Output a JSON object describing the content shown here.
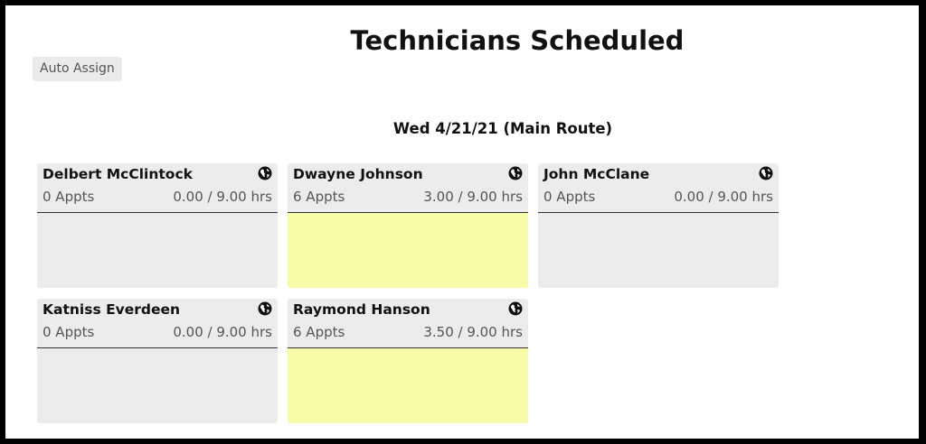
{
  "page": {
    "title": "Technicians Scheduled",
    "auto_assign_label": "Auto Assign",
    "date_header": "Wed 4/21/21 (Main Route)"
  },
  "colors": {
    "card_bg": "#ececec",
    "booked_bg": "#f7fca8",
    "divider": "#333333"
  },
  "technicians": [
    {
      "name": "Delbert McClintock",
      "appts": "0 Appts",
      "hours": "0.00 / 9.00 hrs",
      "status": "empty",
      "icon": "globe-icon"
    },
    {
      "name": "Dwayne Johnson",
      "appts": "6 Appts",
      "hours": "3.00 / 9.00 hrs",
      "status": "booked",
      "icon": "globe-icon"
    },
    {
      "name": "John McClane",
      "appts": "0 Appts",
      "hours": "0.00 / 9.00 hrs",
      "status": "empty",
      "icon": "globe-icon"
    },
    {
      "name": "Katniss Everdeen",
      "appts": "0 Appts",
      "hours": "0.00 / 9.00 hrs",
      "status": "empty",
      "icon": "globe-icon"
    },
    {
      "name": "Raymond Hanson",
      "appts": "6 Appts",
      "hours": "3.50 / 9.00 hrs",
      "status": "booked",
      "icon": "globe-icon"
    }
  ]
}
